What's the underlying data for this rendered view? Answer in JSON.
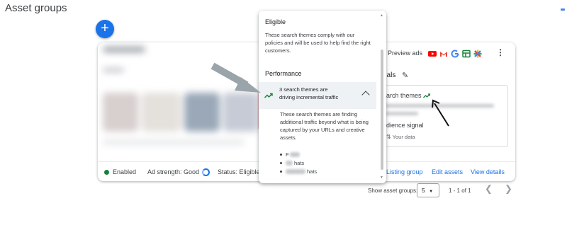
{
  "page": {
    "title": "Asset groups"
  },
  "fab": {
    "label": "+"
  },
  "card": {
    "preview_label": "Preview ads",
    "signals_title": "nals",
    "search_themes_label": "earch themes",
    "audience_signal_label": "udience signal",
    "your_data_label": "Your data",
    "footer": {
      "status_enabled": "Enabled",
      "ad_strength_label": "Ad strength:",
      "ad_strength_value": "Good",
      "status_label": "Status:",
      "status_value": "Eligible",
      "listing_group": "Listing group",
      "edit_assets": "Edit assets",
      "view_details": "View details"
    }
  },
  "pagination": {
    "show_label": "Show asset groups:",
    "page_size": "5",
    "range": "1 - 1 of 1"
  },
  "popover": {
    "eligible_heading": "Eligible",
    "eligible_text": "These search themes comply with our policies and will be used to help find the right customers.",
    "performance_heading": "Performance",
    "performance_item": "3 search themes are driving incremental traffic",
    "performance_body": "These search themes are finding additional traffic beyond what is being captured by your URLs and creative assets.",
    "list": [
      "F",
      "hats",
      "hats"
    ]
  },
  "colors": {
    "accent": "#1a73e8",
    "enabled_green": "#188038",
    "trend_green": "#188038"
  }
}
